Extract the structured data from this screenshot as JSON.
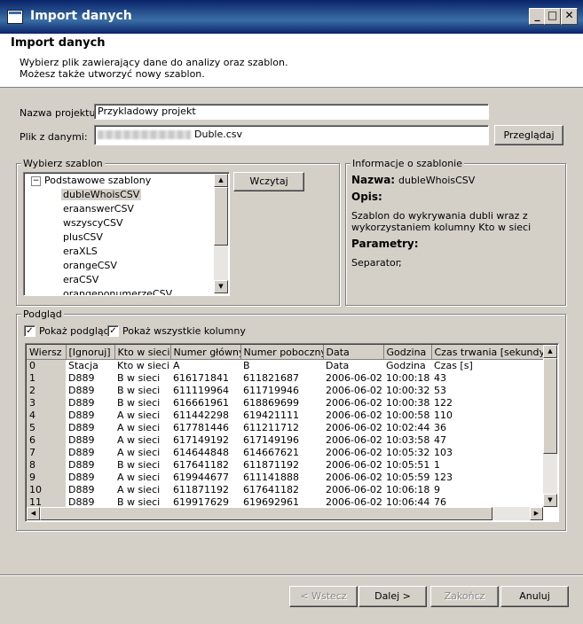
{
  "window": {
    "title": "Import danych",
    "controls": [
      "_",
      "□",
      "✕"
    ]
  },
  "header": {
    "title": "Import danych",
    "desc_line1": "Wybierz plik zawierający dane do analizy oraz szablon.",
    "desc_line2": "Możesz także utworzyć nowy szablon."
  },
  "project": {
    "label": "Nazwa projektu:",
    "value": "Przykladowy projekt"
  },
  "file": {
    "label": "Plik z danymi:",
    "value": "Duble.csv",
    "browse_label": "Przeglądaj"
  },
  "templates": {
    "group_label": "Wybierz szablon",
    "root": "Podstawowe szablony",
    "items": [
      "dubleWhoisCSV",
      "eraanswerCSV",
      "wszyscyCSV",
      "plusCSV",
      "eraXLS",
      "orangeCSV",
      "eraCSV",
      "orangeponumerzeCSV"
    ],
    "load_label": "Wczytaj"
  },
  "info": {
    "group_label": "Informacje o szablonie",
    "name_label": "Nazwa:",
    "name_value": "dubleWhoisCSV",
    "desc_label": "Opis:",
    "desc_line1": "Szablon do wykrywania dubli wraz z",
    "desc_line2": "wykorzystaniem kolumny Kto w sieci",
    "params_label": "Parametry:",
    "param_name": "Separator",
    "param_value": ";"
  },
  "preview": {
    "group_label": "Podgląd",
    "show_preview": "Pokaż podgląd",
    "show_all_columns": "Pokaż wszystkie kolumny",
    "columns": [
      "Wiersz",
      "[Ignoruj]",
      "Kto w sieci",
      "Numer główny",
      "Numer poboczny",
      "Data",
      "Godzina",
      "Czas trwania [sekundy]"
    ],
    "rows": [
      [
        "0",
        "Stacja",
        "Kto w sieci",
        "A",
        "B",
        "Data",
        "Godzina",
        "Czas [s]"
      ],
      [
        "1",
        "D889",
        "B w sieci",
        "616171841",
        "611821687",
        "2006-06-02",
        "10:00:18",
        "43"
      ],
      [
        "2",
        "D889",
        "B w sieci",
        "611119964",
        "611719946",
        "2006-06-02",
        "10:00:32",
        "53"
      ],
      [
        "3",
        "D889",
        "B w sieci",
        "616661961",
        "618869699",
        "2006-06-02",
        "10:00:38",
        "122"
      ],
      [
        "4",
        "D889",
        "A w sieci",
        "611442298",
        "619421111",
        "2006-06-02",
        "10:00:58",
        "110"
      ],
      [
        "5",
        "D889",
        "A w sieci",
        "617781446",
        "611211712",
        "2006-06-02",
        "10:02:44",
        "36"
      ],
      [
        "6",
        "D889",
        "A w sieci",
        "617149192",
        "617149196",
        "2006-06-02",
        "10:03:58",
        "47"
      ],
      [
        "7",
        "D889",
        "A w sieci",
        "614644848",
        "614667621",
        "2006-06-02",
        "10:05:32",
        "103"
      ],
      [
        "8",
        "D889",
        "B w sieci",
        "617641182",
        "611871192",
        "2006-06-02",
        "10:05:51",
        "1"
      ],
      [
        "9",
        "D889",
        "A w sieci",
        "619944677",
        "611141888",
        "2006-06-02",
        "10:05:59",
        "123"
      ],
      [
        "10",
        "D889",
        "A w sieci",
        "611871192",
        "617641182",
        "2006-06-02",
        "10:06:18",
        "9"
      ],
      [
        "11",
        "D889",
        "B w sieci",
        "619917629",
        "619692961",
        "2006-06-02",
        "10:06:44",
        "76"
      ]
    ]
  },
  "footer": {
    "back": "< Wstecz",
    "next": "Dalej >",
    "finish": "Zakończ",
    "cancel": "Anuluj"
  }
}
